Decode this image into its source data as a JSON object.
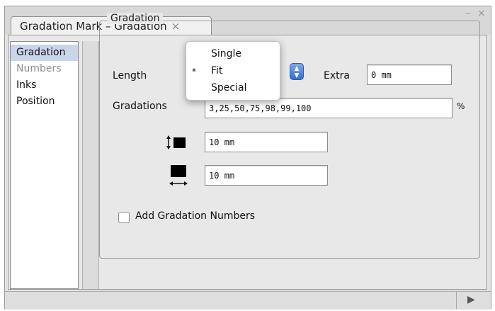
{
  "window": {
    "minimize_label": "–",
    "close_label": "×"
  },
  "tab": {
    "title": "Gradation Mark – Gradation",
    "close_label": "×"
  },
  "sidebar": {
    "items": [
      {
        "label": "Gradation",
        "state": "selected"
      },
      {
        "label": "Numbers",
        "state": "disabled"
      },
      {
        "label": "Inks",
        "state": "normal"
      },
      {
        "label": "Position",
        "state": "normal"
      }
    ]
  },
  "group": {
    "title": "Gradation"
  },
  "length": {
    "label": "Length",
    "selected": "Fit",
    "options": [
      "Single",
      "Fit",
      "Special"
    ],
    "check_mark": "*"
  },
  "extra": {
    "label": "Extra",
    "value": "0 mm"
  },
  "gradations": {
    "label": "Gradations",
    "value": "3,25,50,75,98,99,100",
    "unit": "%"
  },
  "height_field": {
    "icon": "vertical-size-icon",
    "value": "10 mm"
  },
  "width_field": {
    "icon": "horizontal-size-icon",
    "value": "10 mm"
  },
  "add_numbers": {
    "label": "Add Gradation Numbers",
    "checked": false
  },
  "statusbar": {
    "play_icon": "play-icon"
  },
  "colors": {
    "selection": "#c9d6ea",
    "stepper": "#2f6fd6",
    "panel": "#e8e8e8"
  }
}
